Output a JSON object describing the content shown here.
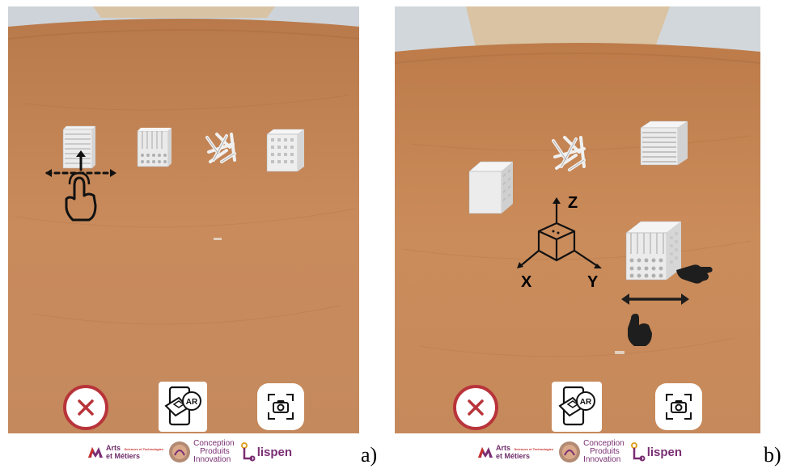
{
  "panels": [
    {
      "id": "a",
      "label": "a)"
    },
    {
      "id": "b",
      "label": "b)"
    }
  ],
  "axes": {
    "x": "X",
    "y": "Y",
    "z": "Z"
  },
  "buttons": {
    "close": "close-button",
    "ar": "AR",
    "camera": "camera-button"
  },
  "logos": {
    "arts_metiers": "Arts et Métiers",
    "arts_metiers_sub": "Sciences et Technologies",
    "conception": "Conception Produits Innovation",
    "conception_lines": [
      "Conception",
      "Produits",
      "Innovation"
    ],
    "lispen": "lispen"
  },
  "colors": {
    "close_accent": "#b8343a",
    "logo_purple": "#7a2e73",
    "table": "#c8875a"
  },
  "icons": [
    "close-icon",
    "ar-phone-icon",
    "camera-icon",
    "hand-drag-icon",
    "axis-gizmo-icon"
  ]
}
